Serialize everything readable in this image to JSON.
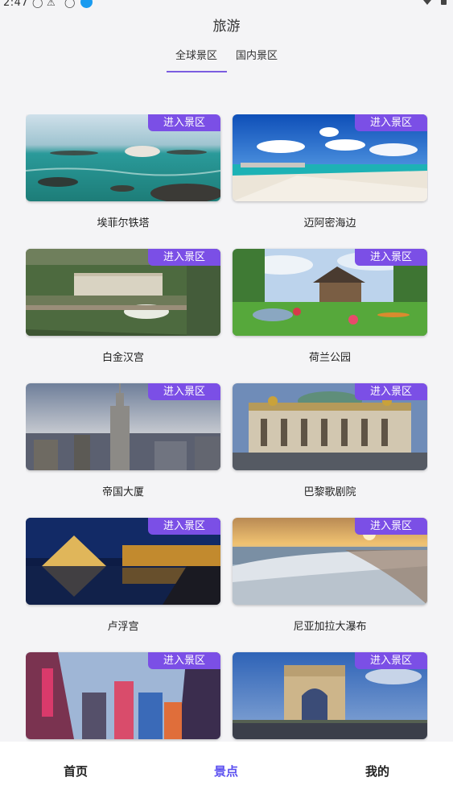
{
  "status_bar": {
    "time": "2:47"
  },
  "header": {
    "title": "旅游"
  },
  "tabs": [
    {
      "label": "全球景区",
      "active": true
    },
    {
      "label": "国内景区",
      "active": false
    }
  ],
  "spots": [
    {
      "name": "埃菲尔铁塔",
      "button": "进入景区"
    },
    {
      "name": "迈阿密海边",
      "button": "进入景区"
    },
    {
      "name": "白金汉宫",
      "button": "进入景区"
    },
    {
      "name": "荷兰公园",
      "button": "进入景区"
    },
    {
      "name": "帝国大厦",
      "button": "进入景区"
    },
    {
      "name": "巴黎歌剧院",
      "button": "进入景区"
    },
    {
      "name": "卢浮宫",
      "button": "进入景区"
    },
    {
      "name": "尼亚加拉大瀑布",
      "button": "进入景区"
    },
    {
      "name": "",
      "button": "进入景区"
    },
    {
      "name": "",
      "button": "进入景区"
    }
  ],
  "bottom_nav": {
    "home": "首页",
    "spots": "景点",
    "mine": "我的"
  },
  "colors": {
    "accent": "#7b4fe6",
    "nav_active": "#5b4ff0",
    "background": "#f4f4f6"
  }
}
